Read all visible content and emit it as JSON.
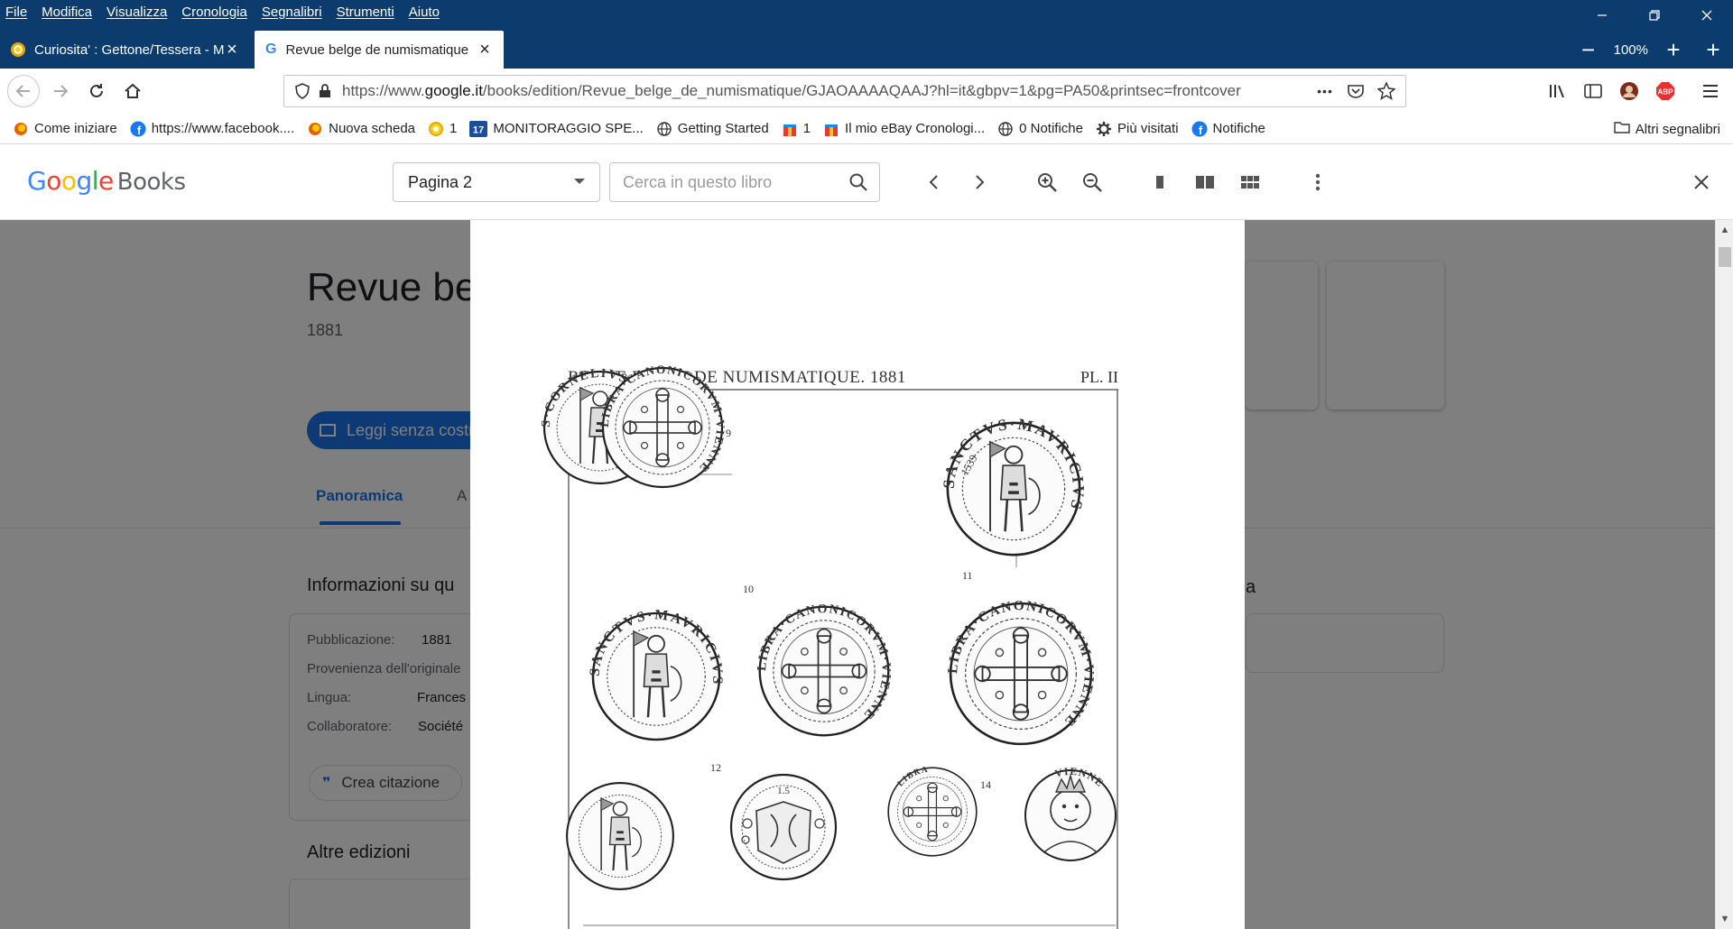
{
  "browser": {
    "menu": [
      "File",
      "Modifica",
      "Visualizza",
      "Cronologia",
      "Segnalibri",
      "Strumenti",
      "Aiuto"
    ],
    "tabs": [
      {
        "title": "Curiosita' : Gettone/Tessera - M",
        "active": false
      },
      {
        "title": "Revue belge de numismatique",
        "active": true
      }
    ],
    "zoom": "100%",
    "url_prefix": "https://www.",
    "url_domain": "google.it",
    "url_rest": "/books/edition/Revue_belge_de_numismatique/GJAOAAAAQAAJ?hl=it&gbpv=1&pg=PA50&printsec=frontcover",
    "url_dots": "•••",
    "bookmarks": [
      {
        "label": "Come iniziare",
        "icon": "firefox-icon"
      },
      {
        "label": "https://www.facebook....",
        "icon": "facebook-icon"
      },
      {
        "label": "Nuova scheda",
        "icon": "firefox-icon"
      },
      {
        "label": "1",
        "icon": "yellow-circle-icon"
      },
      {
        "label": "MONITORAGGIO SPE...",
        "icon": "calendar-icon",
        "badge": "17"
      },
      {
        "label": "Getting Started",
        "icon": "globe-icon"
      },
      {
        "label": "1",
        "icon": "gift-icon"
      },
      {
        "label": "Il mio eBay Cronologi...",
        "icon": "gift-icon"
      },
      {
        "label": "0 Notifiche",
        "icon": "globe-icon"
      },
      {
        "label": "Più visitati",
        "icon": "gear-icon"
      },
      {
        "label": "Notifiche",
        "icon": "facebook-icon"
      }
    ],
    "other_bookmarks": "Altri segnalibri"
  },
  "books_toolbar": {
    "logo_google": "Google",
    "logo_books": "Books",
    "page_select": "Pagina 2",
    "search_placeholder": "Cerca in questo libro"
  },
  "background_page": {
    "title": "Revue bel",
    "year": "1881",
    "read_button": "Leggi senza costi",
    "tab_overview": "Panoramica",
    "tab_other": "A",
    "info_heading": "Informazioni su qu",
    "info": [
      {
        "label": "Pubblicazione:",
        "value": "1881"
      },
      {
        "label": "Provenienza dell'originale",
        "value": ""
      },
      {
        "label": "Lingua:",
        "value": "Frances"
      },
      {
        "label": "Collaboratore:",
        "value": "Société"
      }
    ],
    "cite_button": "Crea citazione",
    "other_editions": "Altre edizioni",
    "right_heading_fragment": "a"
  },
  "plate": {
    "header_left": "REVUE BELGE DE NUMISMATIQUE. 1881",
    "header_right": "PL. II",
    "numbers": [
      "9",
      "10",
      "11",
      "12",
      "14"
    ],
    "coin_legends": [
      "S·CORNELIVS",
      "LIBRA·CANONICORVM·VIENNE",
      "SANCTVS·MAVRICIVS",
      "SANCTVS·MAVRICIVS",
      "LIBRA·CANONICORVM·VIENNE",
      "LIBRA·CANONICORVM·VIENNE",
      "",
      "1.5",
      "LIBRA",
      "VIENNE"
    ],
    "coin_year": "1539"
  }
}
